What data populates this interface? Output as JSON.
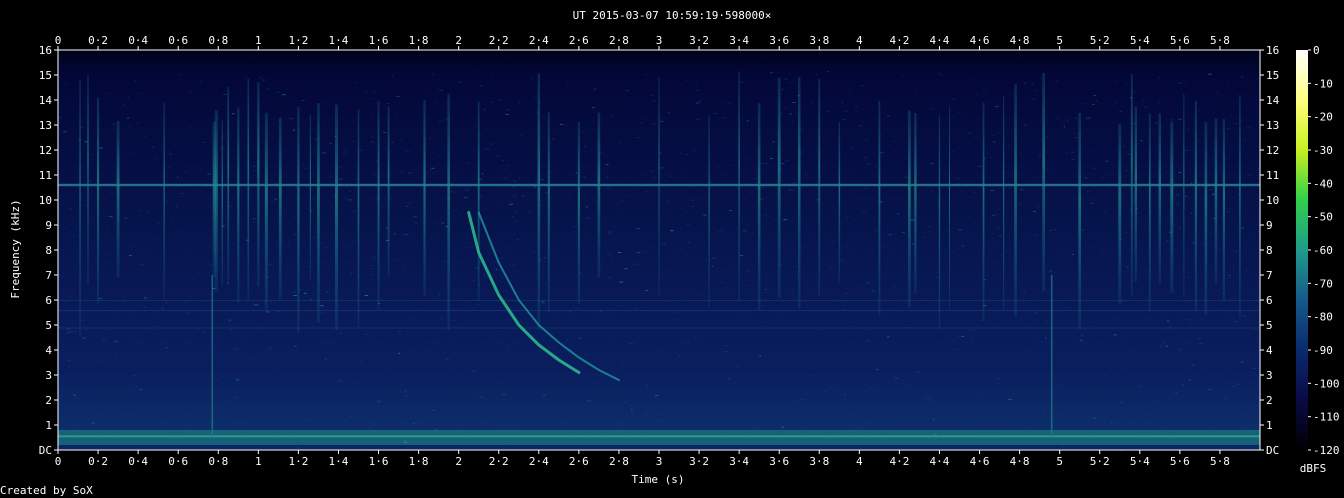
{
  "chart_data": {
    "type": "heatmap",
    "subtype": "spectrogram",
    "title": "UT 2015-03-07 10:59:19·598000×",
    "xlabel": "Time (s)",
    "ylabel": "Frequency (kHz)",
    "xlim": [
      0,
      6.0
    ],
    "ylim": [
      0,
      16
    ],
    "x_ticks": [
      "0",
      "0·2",
      "0·4",
      "0·6",
      "0·8",
      "1",
      "1·2",
      "1·4",
      "1·6",
      "1·8",
      "2",
      "2·2",
      "2·4",
      "2·6",
      "2·8",
      "3",
      "3·2",
      "3·4",
      "3·6",
      "3·8",
      "4",
      "4·2",
      "4·4",
      "4·6",
      "4·8",
      "5",
      "5·2",
      "5·4",
      "5·6",
      "5·8"
    ],
    "x_tick_values": [
      0,
      0.2,
      0.4,
      0.6,
      0.8,
      1.0,
      1.2,
      1.4,
      1.6,
      1.8,
      2.0,
      2.2,
      2.4,
      2.6,
      2.8,
      3.0,
      3.2,
      3.4,
      3.6,
      3.8,
      4.0,
      4.2,
      4.4,
      4.6,
      4.8,
      5.0,
      5.2,
      5.4,
      5.6,
      5.8
    ],
    "y_ticks": [
      "DC",
      "1",
      "2",
      "3",
      "4",
      "5",
      "6",
      "7",
      "8",
      "9",
      "10",
      "11",
      "12",
      "13",
      "14",
      "15",
      "16"
    ],
    "y_tick_values": [
      0,
      1,
      2,
      3,
      4,
      5,
      6,
      7,
      8,
      9,
      10,
      11,
      12,
      13,
      14,
      15,
      16
    ],
    "colorbar": {
      "label": "dBFS",
      "ticks": [
        "0",
        "-10",
        "-20",
        "-30",
        "-40",
        "-50",
        "-60",
        "-70",
        "-80",
        "-90",
        "-100",
        "-110",
        "-120"
      ],
      "tick_values": [
        0,
        -10,
        -20,
        -30,
        -40,
        -50,
        -60,
        -70,
        -80,
        -90,
        -100,
        -110,
        -120
      ],
      "range": [
        -120,
        0
      ],
      "colors": [
        "#000000",
        "#0a0a45",
        "#0a2a6e",
        "#155a8a",
        "#1f9a8a",
        "#2fd04a",
        "#c8f020",
        "#ffff80",
        "#ffffff"
      ]
    },
    "features": {
      "horizontal_line_khz": 10.6,
      "low_freq_band_khz": [
        0.2,
        0.8
      ],
      "whistler_traces": [
        {
          "name": "",
          "points": [
            [
              2.05,
              9.5
            ],
            [
              2.1,
              7.9
            ],
            [
              2.2,
              6.2
            ],
            [
              2.3,
              5.0
            ],
            [
              2.4,
              4.2
            ],
            [
              2.5,
              3.6
            ],
            [
              2.6,
              3.1
            ]
          ]
        },
        {
          "name": "",
          "points": [
            [
              2.1,
              9.5
            ],
            [
              2.2,
              7.5
            ],
            [
              2.3,
              6.0
            ],
            [
              2.4,
              5.0
            ],
            [
              2.5,
              4.3
            ],
            [
              2.6,
              3.7
            ],
            [
              2.7,
              3.2
            ],
            [
              2.8,
              2.8
            ]
          ]
        }
      ],
      "sferic_times_s": [
        0.11,
        0.15,
        0.2,
        0.3,
        0.53,
        0.78,
        0.79,
        0.82,
        0.85,
        0.9,
        0.95,
        1.0,
        1.04,
        1.11,
        1.2,
        1.26,
        1.3,
        1.39,
        1.5,
        1.6,
        1.65,
        1.83,
        1.95,
        2.1,
        2.4,
        2.45,
        2.6,
        2.7,
        3.0,
        3.25,
        3.4,
        3.5,
        3.6,
        3.7,
        3.8,
        3.9,
        4.1,
        4.25,
        4.28,
        4.4,
        4.45,
        4.62,
        4.72,
        4.78,
        4.92,
        5.1,
        5.3,
        5.36,
        5.38,
        5.45,
        5.5,
        5.56,
        5.62,
        5.68,
        5.73,
        5.78,
        5.82,
        5.9
      ],
      "sferic_vertical_full_height_times_s": [
        0.77,
        4.96
      ]
    }
  },
  "footer": {
    "creator": "Created by SoX"
  }
}
